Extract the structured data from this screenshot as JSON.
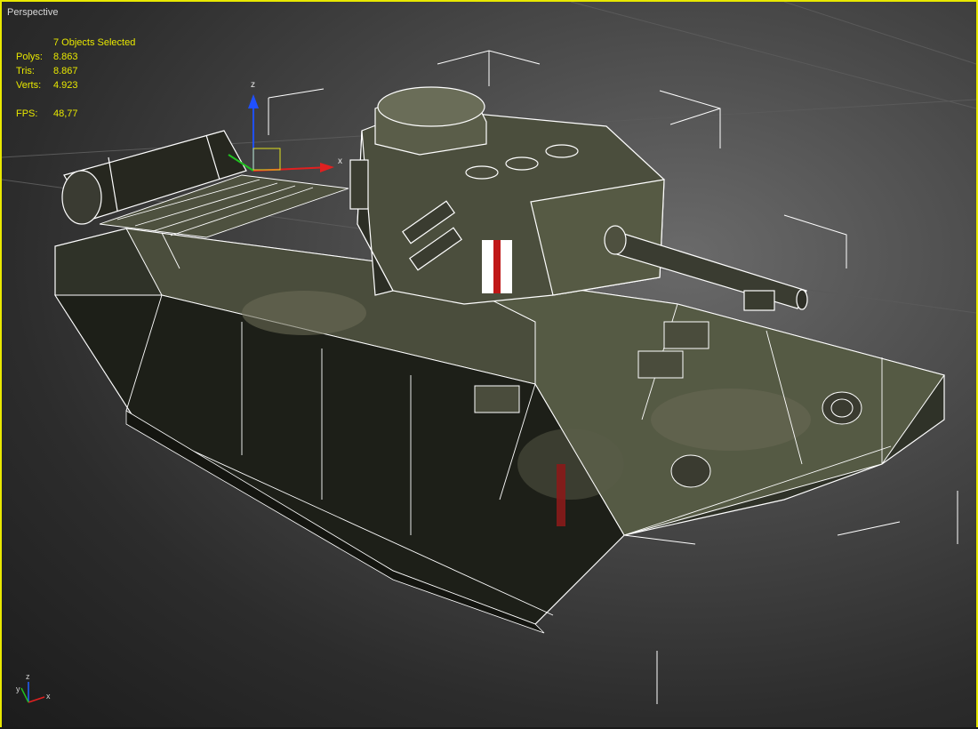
{
  "viewport": {
    "label": "Perspective",
    "border_color": "#e8e800"
  },
  "stats": {
    "selection": "7 Objects Selected",
    "polys_label": "Polys:",
    "polys_value": "8.863",
    "tris_label": "Tris:",
    "tris_value": "8.867",
    "verts_label": "Verts:",
    "verts_value": "4.923",
    "fps_label": "FPS:",
    "fps_value": "48,77",
    "text_color": "#e8e800"
  },
  "gizmo": {
    "z_label": "z",
    "x_label": "x"
  },
  "axis_tripod": {
    "z_label": "z",
    "y_label": "y",
    "x_label": "x"
  },
  "icons": {
    "move_gizmo": "move-gizmo-icon",
    "view_axis": "view-axis-tripod-icon"
  }
}
